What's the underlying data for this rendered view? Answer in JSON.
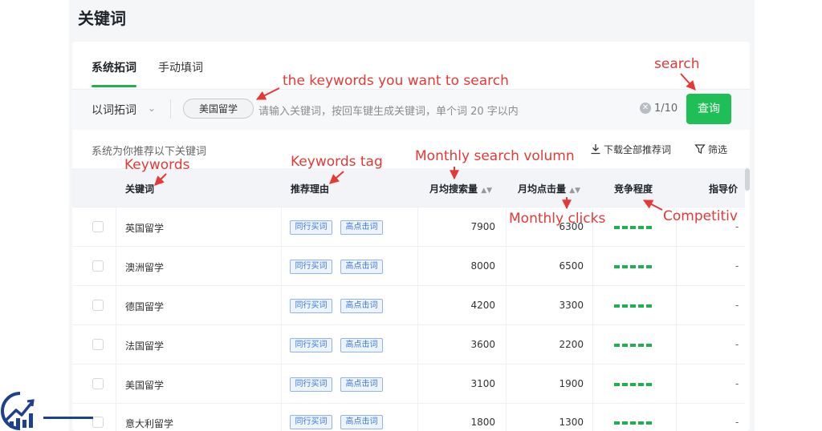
{
  "header": {
    "title": "关键词"
  },
  "tabs": [
    {
      "label": "系统拓词"
    },
    {
      "label": "手动填词"
    }
  ],
  "search": {
    "mode": "以词拓词",
    "tag": "美国留学",
    "placeholder": "请输入关键词，按回车键生成关键词，单个词 20 字以内",
    "count": "1/10",
    "button": "查询"
  },
  "toolbar": {
    "recommend_text": "系统为你推荐以下关键词",
    "download_label": "下载全部推荐词",
    "filter_label": "筛选"
  },
  "table": {
    "columns": {
      "keyword": "关键词",
      "reason": "推荐理由",
      "search": "月均搜索量",
      "clicks": "月均点击量",
      "competition": "竞争程度",
      "price": "指导价"
    },
    "tag_labels": {
      "peer": "同行买词",
      "highclick": "高点击词"
    },
    "rows": [
      {
        "keyword": "英国留学",
        "search": "7900",
        "clicks": "6300",
        "price": "-"
      },
      {
        "keyword": "澳洲留学",
        "search": "8000",
        "clicks": "6500",
        "price": "-"
      },
      {
        "keyword": "德国留学",
        "search": "4200",
        "clicks": "3300",
        "price": "-"
      },
      {
        "keyword": "法国留学",
        "search": "3600",
        "clicks": "2200",
        "price": "-"
      },
      {
        "keyword": "美国留学",
        "search": "3100",
        "clicks": "1900",
        "price": "-"
      },
      {
        "keyword": "意大利留学",
        "search": "1800",
        "clicks": "1300",
        "price": "-"
      }
    ]
  },
  "annotations": {
    "search": "search",
    "keywords_want": "the keywords you want to search",
    "monthly_search": "Monthly search volumn",
    "keywords_tag": "Keywords tag",
    "keywords": "Keywords",
    "monthly_clicks": "Monthly clicks",
    "competitive": "Competitiv"
  },
  "colors": {
    "accent": "#1fbf58",
    "annotation": "#e53935",
    "tag_blue": "#3a78d8"
  },
  "icons": {
    "clear": "clear-icon",
    "download": "download-icon",
    "filter": "filter-icon",
    "chevron": "chevron-down-icon",
    "sort": "sort-icon",
    "logo": "chart-logo-icon"
  }
}
